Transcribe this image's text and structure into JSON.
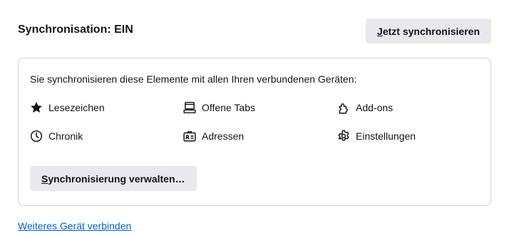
{
  "sync": {
    "title": "Synchronisation: EIN",
    "sync_now_label_accel": "J",
    "sync_now_label_rest": "etzt synchronisieren"
  },
  "card": {
    "intro": "Sie synchronisieren diese Elemente mit allen Ihren verbundenen Geräten:",
    "engines": [
      {
        "icon": "star-icon",
        "label": "Lesezeichen"
      },
      {
        "icon": "open-tabs-icon",
        "label": "Offene Tabs"
      },
      {
        "icon": "puzzle-piece-icon",
        "label": "Add-ons"
      },
      {
        "icon": "clock-icon",
        "label": "Chronik"
      },
      {
        "icon": "address-card-icon",
        "label": "Adressen"
      },
      {
        "icon": "gear-icon",
        "label": "Einstellungen"
      }
    ],
    "manage_label_accel": "S",
    "manage_label_rest": "ynchronisierung verwalten…"
  },
  "connect_device_link": "Weiteres Gerät verbinden"
}
